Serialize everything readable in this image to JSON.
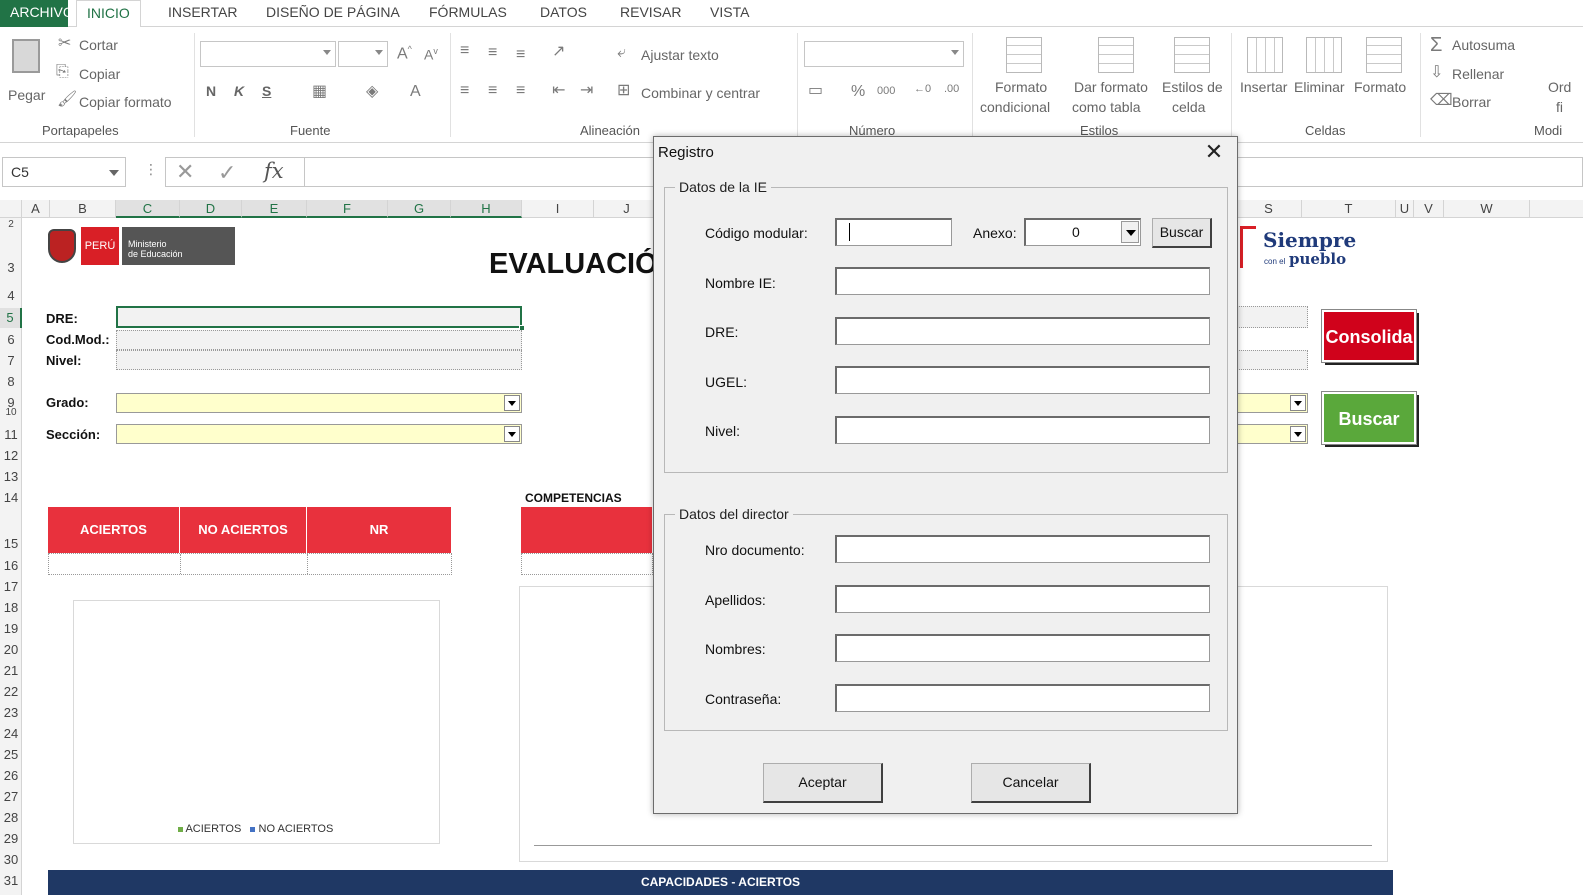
{
  "ribbon": {
    "tabs": [
      "ARCHIVO",
      "INICIO",
      "INSERTAR",
      "DISEÑO DE PÁGINA",
      "FÓRMULAS",
      "DATOS",
      "REVISAR",
      "VISTA"
    ],
    "clipboard": {
      "paste": "Pegar",
      "cut": "Cortar",
      "copy": "Copiar",
      "format_painter": "Copiar formato",
      "label": "Portapapeles"
    },
    "font": {
      "bold": "N",
      "italic": "K",
      "underline": "S",
      "label": "Fuente"
    },
    "alignment": {
      "wrap": "Ajustar texto",
      "merge": "Combinar y centrar",
      "label": "Alineación"
    },
    "number": {
      "label": "Número"
    },
    "styles": {
      "cond_format_1": "Formato",
      "cond_format_2": "condicional",
      "table_1": "Dar formato",
      "table_2": "como tabla",
      "cell_1": "Estilos de",
      "cell_2": "celda",
      "label": "Estilos"
    },
    "cells": {
      "insert": "Insertar",
      "delete": "Eliminar",
      "format": "Formato",
      "label": "Celdas"
    },
    "editing": {
      "autosum": "Autosuma",
      "fill": "Rellenar",
      "clear": "Borrar",
      "sort_1": "Ord",
      "sort_2": "fi",
      "label": "Modi"
    }
  },
  "formula_bar": {
    "name_box": "C5",
    "formula": ""
  },
  "grid": {
    "columns": [
      "A",
      "B",
      "C",
      "D",
      "E",
      "F",
      "G",
      "H",
      "I",
      "J",
      "S",
      "T",
      "U",
      "V",
      "W"
    ],
    "rows": [
      "2",
      "3",
      "4",
      "5",
      "6",
      "7",
      "8",
      "9",
      "10",
      "11",
      "12",
      "13",
      "14",
      "15",
      "16",
      "17",
      "18",
      "19",
      "20",
      "21",
      "22",
      "23",
      "24",
      "25",
      "26",
      "27",
      "28",
      "29",
      "30",
      "31"
    ]
  },
  "sheet": {
    "peru": "PERÚ",
    "ministry_1": "Ministerio",
    "ministry_2": "de Educación",
    "siempre_1": "Siempre",
    "siempre_2": "con el",
    "siempre_3": "pueblo",
    "title": "EVALUACIÓN",
    "dre_label": "DRE:",
    "codmod_label": "Cod.Mod.:",
    "nivel_label": "Nivel:",
    "grado_label": "Grado:",
    "seccion_label": "Sección:",
    "competencias": "COMPETENCIAS",
    "headers": [
      "ACIERTOS",
      "NO ACIERTOS",
      "NR"
    ],
    "legend_aciertos": "ACIERTOS",
    "legend_no_aciertos": "NO ACIERTOS",
    "bottom_banner": "CAPACIDADES - ACIERTOS",
    "consolida_btn": "Consolida",
    "buscar_btn": "Buscar",
    "colors": {
      "red": "#e8313d",
      "green_btn": "#5aa83b",
      "red_btn": "#d0021b",
      "navy": "#1f3864"
    }
  },
  "dialog": {
    "title": "Registro",
    "ie_section": "Datos de la IE",
    "codigo_label": "Código modular:",
    "codigo_value": "",
    "anexo_label": "Anexo:",
    "anexo_value": "0",
    "buscar": "Buscar",
    "nombre_label": "Nombre IE:",
    "dre_label": "DRE:",
    "ugel_label": "UGEL:",
    "nivel_label": "Nivel:",
    "director_section": "Datos del director",
    "doc_label": "Nro documento:",
    "apellidos_label": "Apellidos:",
    "nombres_label": "Nombres:",
    "password_label": "Contraseña:",
    "accept": "Aceptar",
    "cancel": "Cancelar"
  }
}
